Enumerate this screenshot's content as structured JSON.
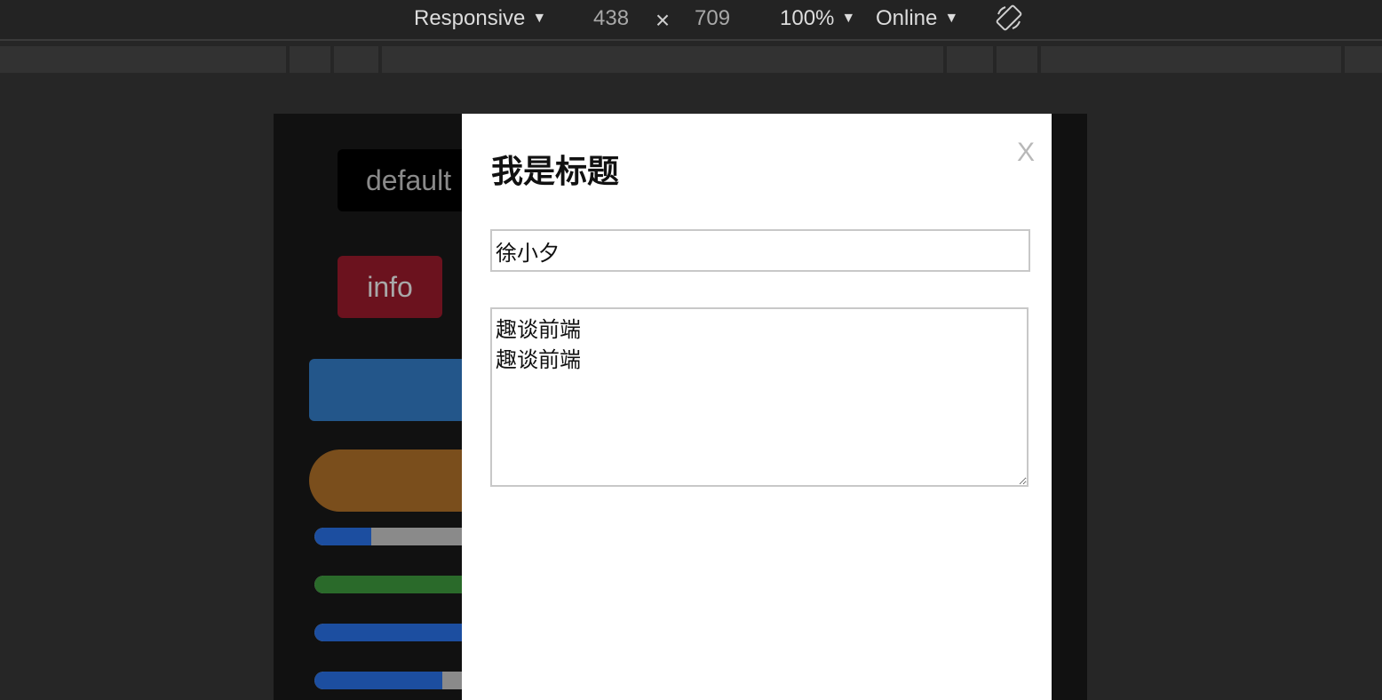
{
  "device_toolbar": {
    "device_mode": "Responsive",
    "width": "438",
    "times": "×",
    "height": "709",
    "zoom": "100%",
    "network": "Online",
    "arrow": "▼"
  },
  "page": {
    "buttons": {
      "default_label": "default",
      "info_label": "info"
    },
    "colors": {
      "default_bg": "#000000",
      "info_bg": "#6b121e",
      "primary_bg": "#23568a",
      "warning_bg": "#7a4e1c"
    },
    "progress_bars": [
      {
        "fraction": 0.32,
        "color": "#1c4ea0"
      },
      {
        "fraction": 1.0,
        "color": "#2a6a2a"
      },
      {
        "fraction": 1.0,
        "color": "#1c4ea0"
      },
      {
        "fraction": 0.72,
        "color": "#1c4ea0"
      }
    ]
  },
  "modal": {
    "title": "我是标题",
    "close_label": "X",
    "input_value": "徐小夕",
    "textarea_value": "趣谈前端\n趣谈前端"
  }
}
